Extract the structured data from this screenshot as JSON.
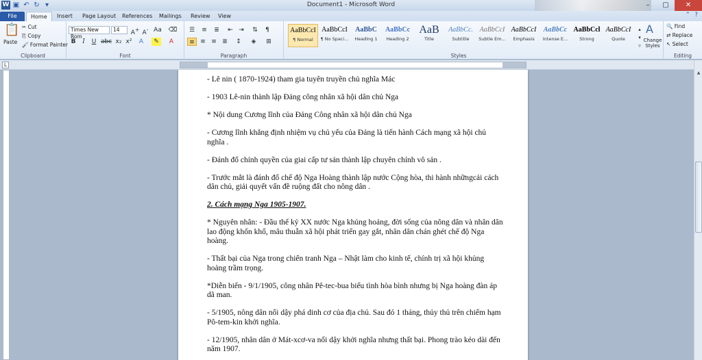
{
  "window": {
    "title": "Document1 - Microsoft Word"
  },
  "tabs": [
    "File",
    "Home",
    "Insert",
    "Page Layout",
    "References",
    "Mailings",
    "Review",
    "View"
  ],
  "ribbon": {
    "clipboard": {
      "label": "Clipboard",
      "paste": "Paste",
      "cut": "Cut",
      "copy": "Copy",
      "format_painter": "Format Painter"
    },
    "font": {
      "label": "Font",
      "font_name": "Times New Rom",
      "font_size": "14"
    },
    "paragraph": {
      "label": "Paragraph"
    },
    "styles": {
      "label": "Styles",
      "items": [
        {
          "sample": "AaBbCcI",
          "name": "¶ Normal"
        },
        {
          "sample": "AaBbCcI",
          "name": "¶ No Spaci..."
        },
        {
          "sample": "AaBbC",
          "name": "Heading 1"
        },
        {
          "sample": "AaBbCc",
          "name": "Heading 2"
        },
        {
          "sample": "AaB",
          "name": "Title"
        },
        {
          "sample": "AaBbCc.",
          "name": "Subtitle"
        },
        {
          "sample": "AaBbCcI",
          "name": "Subtle Em..."
        },
        {
          "sample": "AaBbCcI",
          "name": "Emphasis"
        },
        {
          "sample": "AaBbCc",
          "name": "Intense E..."
        },
        {
          "sample": "AaBbCcl",
          "name": "Strong"
        },
        {
          "sample": "AaBbCcI",
          "name": "Quote"
        }
      ],
      "change_styles": "Change Styles"
    },
    "editing": {
      "label": "Editing",
      "find": "Find",
      "replace": "Replace",
      "select": "Select"
    }
  },
  "document": {
    "paragraphs": [
      "- Lê nin ( 1870-1924) tham gia tuyên truyền chủ nghĩa Mác",
      "- 1903 Lê-nin thành lập Đảng công nhân xã hội dân chủ Nga",
      "* Nội dung Cương lĩnh của Đảng Công nhân xã hội dân chủ Nga",
      "- Cương lĩnh khẳng định nhiệm vụ chủ yếu của Đảng là tiến hành Cách mạng xã hội chủ nghĩa .",
      "- Đánh đổ chính quyền của giai cấp tư sản thành lập chuyên chính vô sản .",
      "- Trước mắt là đánh đổ chế độ Nga Hoàng thành lập nước Cộng hòa, thi hành nhữngcải cách dân chủ, giải quyết vấn đề ruộng đất cho nông dân .",
      "2. Cách mạng Nga 1905-1907.",
      "* Nguyên nhân: - Đầu thế kỷ XX nước Nga khủng hoảng, đời sống của nông dân và nhân dân lao động khốn khổ, mâu thuẫn xã hội phát triển gay gắt, nhân dân chán ghét chế độ Nga hoàng.",
      "- Thất bại của Nga trong chiến tranh Nga – Nhật làm cho kinh tế, chính trị xã hội khủng hoảng trầm trọng.",
      "*Diễn biến - 9/1/1905, công nhân Pê-tec-bua biểu tình hòa bình nhưng bị Nga hoàng đàn áp dã man.",
      "- 5/1905, nông dân nổi dậy phá dinh cơ của địa chủ. Sau đó 1 tháng, thủy thủ trên chiếm hạm Pô-tem-kin khởi nghĩa.",
      "- 12/1905, nhân dân ở Mát-xcơ-va nổi dậy khởi nghĩa nhưng thất bại. Phong trào kéo dài đến năm 1907."
    ]
  }
}
